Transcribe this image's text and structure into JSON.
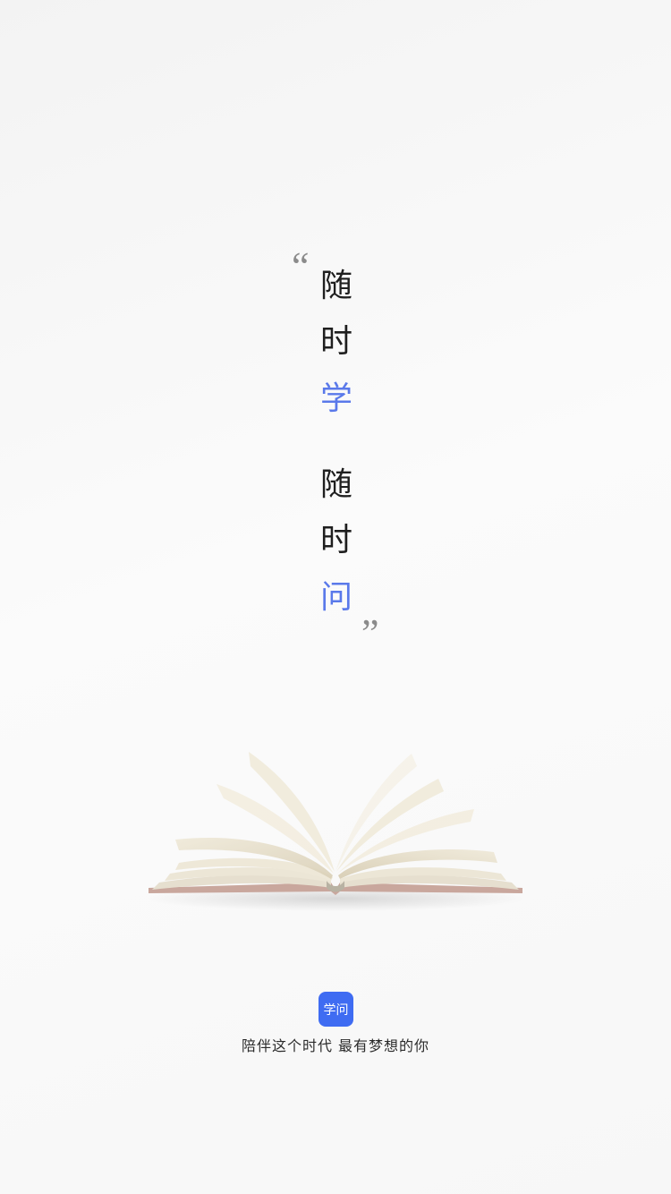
{
  "quote": {
    "open_mark": "“",
    "close_mark": "”"
  },
  "vertical_text": {
    "chars": [
      "随",
      "时",
      "学",
      "随",
      "时",
      "问"
    ],
    "accent_color": "#5a79ea",
    "text_color": "#1f1f1f"
  },
  "illustration": {
    "icon": "open-book-icon"
  },
  "brand": {
    "badge_label": "学问",
    "badge_color": "#3f6cf2",
    "tagline": "陪伴这个时代 最有梦想的你"
  }
}
